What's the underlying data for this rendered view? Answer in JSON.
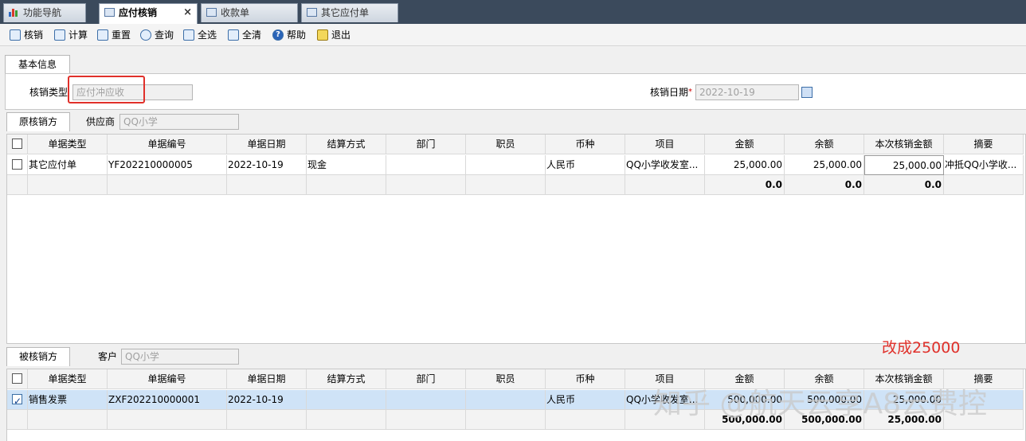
{
  "tabs": [
    {
      "label": "功能导航",
      "icon": "bar-chart-icon"
    },
    {
      "label": "应付核销",
      "icon": "form-icon",
      "active": true,
      "close": "×"
    },
    {
      "label": "收款单",
      "icon": "form-icon"
    },
    {
      "label": "其它应付单",
      "icon": "form-icon"
    }
  ],
  "toolbar": {
    "verify": "核销",
    "calc": "计算",
    "reset": "重置",
    "query": "查询",
    "select_all": "全选",
    "clear_all": "全清",
    "help": "帮助",
    "exit": "退出"
  },
  "basic": {
    "tab": "基本信息",
    "type_label": "核销类型",
    "type_value": "应付冲应收",
    "date_label": "核销日期",
    "date_value": "2022-10-19"
  },
  "original": {
    "tab": "原核销方",
    "party_label": "供应商",
    "party_value": "QQ小学"
  },
  "target": {
    "tab": "被核销方",
    "party_label": "客户",
    "party_value": "QQ小学"
  },
  "columns": [
    "单据类型",
    "单据编号",
    "单据日期",
    "结算方式",
    "部门",
    "职员",
    "币种",
    "项目",
    "金额",
    "余额",
    "本次核销金额",
    "摘要"
  ],
  "original_rows": [
    {
      "checked": false,
      "type": "其它应付单",
      "no": "YF202210000005",
      "date": "2022-10-19",
      "settle": "现金",
      "dept": "",
      "staff": "",
      "currency": "人民币",
      "project": "QQ小学收发室...",
      "amount": "25,000.00",
      "balance": "25,000.00",
      "this_amount": "25,000.00",
      "memo": "冲抵QQ小学收..."
    }
  ],
  "original_sum": {
    "amount": "0.0",
    "balance": "0.0",
    "this_amount": "0.0"
  },
  "target_rows": [
    {
      "checked": true,
      "type": "销售发票",
      "no": "ZXF202210000001",
      "date": "2022-10-19",
      "settle": "",
      "dept": "",
      "staff": "",
      "currency": "人民币",
      "project": "QQ小学收发室...",
      "amount": "500,000.00",
      "balance": "500,000.00",
      "this_amount": "25,000.00",
      "memo": ""
    }
  ],
  "target_sum": {
    "amount": "500,000.00",
    "balance": "500,000.00",
    "this_amount": "25,000.00"
  },
  "annotation": "改成25000",
  "watermark": "知乎 @航天云享A8云费控"
}
